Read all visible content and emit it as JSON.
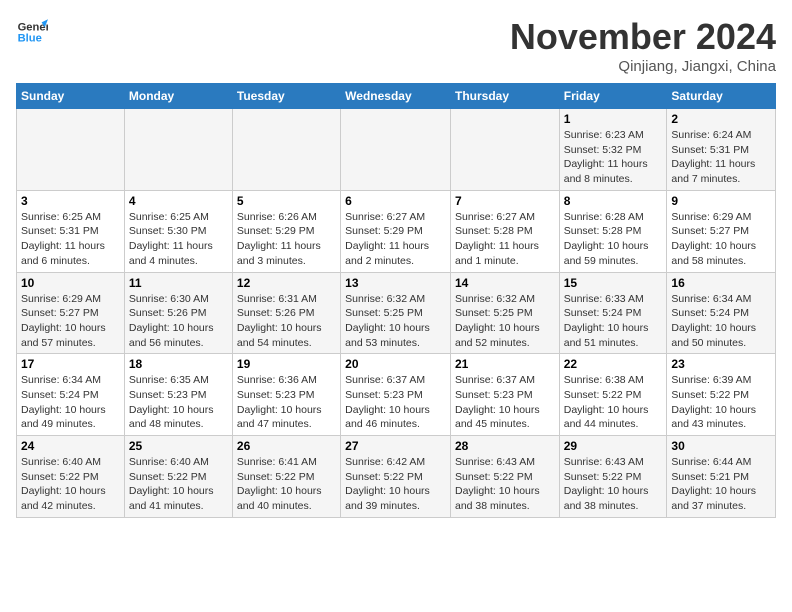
{
  "header": {
    "logo_line1": "General",
    "logo_line2": "Blue",
    "month": "November 2024",
    "location": "Qinjiang, Jiangxi, China"
  },
  "weekdays": [
    "Sunday",
    "Monday",
    "Tuesday",
    "Wednesday",
    "Thursday",
    "Friday",
    "Saturday"
  ],
  "weeks": [
    [
      {
        "day": "",
        "info": ""
      },
      {
        "day": "",
        "info": ""
      },
      {
        "day": "",
        "info": ""
      },
      {
        "day": "",
        "info": ""
      },
      {
        "day": "",
        "info": ""
      },
      {
        "day": "1",
        "info": "Sunrise: 6:23 AM\nSunset: 5:32 PM\nDaylight: 11 hours and 8 minutes."
      },
      {
        "day": "2",
        "info": "Sunrise: 6:24 AM\nSunset: 5:31 PM\nDaylight: 11 hours and 7 minutes."
      }
    ],
    [
      {
        "day": "3",
        "info": "Sunrise: 6:25 AM\nSunset: 5:31 PM\nDaylight: 11 hours and 6 minutes."
      },
      {
        "day": "4",
        "info": "Sunrise: 6:25 AM\nSunset: 5:30 PM\nDaylight: 11 hours and 4 minutes."
      },
      {
        "day": "5",
        "info": "Sunrise: 6:26 AM\nSunset: 5:29 PM\nDaylight: 11 hours and 3 minutes."
      },
      {
        "day": "6",
        "info": "Sunrise: 6:27 AM\nSunset: 5:29 PM\nDaylight: 11 hours and 2 minutes."
      },
      {
        "day": "7",
        "info": "Sunrise: 6:27 AM\nSunset: 5:28 PM\nDaylight: 11 hours and 1 minute."
      },
      {
        "day": "8",
        "info": "Sunrise: 6:28 AM\nSunset: 5:28 PM\nDaylight: 10 hours and 59 minutes."
      },
      {
        "day": "9",
        "info": "Sunrise: 6:29 AM\nSunset: 5:27 PM\nDaylight: 10 hours and 58 minutes."
      }
    ],
    [
      {
        "day": "10",
        "info": "Sunrise: 6:29 AM\nSunset: 5:27 PM\nDaylight: 10 hours and 57 minutes."
      },
      {
        "day": "11",
        "info": "Sunrise: 6:30 AM\nSunset: 5:26 PM\nDaylight: 10 hours and 56 minutes."
      },
      {
        "day": "12",
        "info": "Sunrise: 6:31 AM\nSunset: 5:26 PM\nDaylight: 10 hours and 54 minutes."
      },
      {
        "day": "13",
        "info": "Sunrise: 6:32 AM\nSunset: 5:25 PM\nDaylight: 10 hours and 53 minutes."
      },
      {
        "day": "14",
        "info": "Sunrise: 6:32 AM\nSunset: 5:25 PM\nDaylight: 10 hours and 52 minutes."
      },
      {
        "day": "15",
        "info": "Sunrise: 6:33 AM\nSunset: 5:24 PM\nDaylight: 10 hours and 51 minutes."
      },
      {
        "day": "16",
        "info": "Sunrise: 6:34 AM\nSunset: 5:24 PM\nDaylight: 10 hours and 50 minutes."
      }
    ],
    [
      {
        "day": "17",
        "info": "Sunrise: 6:34 AM\nSunset: 5:24 PM\nDaylight: 10 hours and 49 minutes."
      },
      {
        "day": "18",
        "info": "Sunrise: 6:35 AM\nSunset: 5:23 PM\nDaylight: 10 hours and 48 minutes."
      },
      {
        "day": "19",
        "info": "Sunrise: 6:36 AM\nSunset: 5:23 PM\nDaylight: 10 hours and 47 minutes."
      },
      {
        "day": "20",
        "info": "Sunrise: 6:37 AM\nSunset: 5:23 PM\nDaylight: 10 hours and 46 minutes."
      },
      {
        "day": "21",
        "info": "Sunrise: 6:37 AM\nSunset: 5:23 PM\nDaylight: 10 hours and 45 minutes."
      },
      {
        "day": "22",
        "info": "Sunrise: 6:38 AM\nSunset: 5:22 PM\nDaylight: 10 hours and 44 minutes."
      },
      {
        "day": "23",
        "info": "Sunrise: 6:39 AM\nSunset: 5:22 PM\nDaylight: 10 hours and 43 minutes."
      }
    ],
    [
      {
        "day": "24",
        "info": "Sunrise: 6:40 AM\nSunset: 5:22 PM\nDaylight: 10 hours and 42 minutes."
      },
      {
        "day": "25",
        "info": "Sunrise: 6:40 AM\nSunset: 5:22 PM\nDaylight: 10 hours and 41 minutes."
      },
      {
        "day": "26",
        "info": "Sunrise: 6:41 AM\nSunset: 5:22 PM\nDaylight: 10 hours and 40 minutes."
      },
      {
        "day": "27",
        "info": "Sunrise: 6:42 AM\nSunset: 5:22 PM\nDaylight: 10 hours and 39 minutes."
      },
      {
        "day": "28",
        "info": "Sunrise: 6:43 AM\nSunset: 5:22 PM\nDaylight: 10 hours and 38 minutes."
      },
      {
        "day": "29",
        "info": "Sunrise: 6:43 AM\nSunset: 5:22 PM\nDaylight: 10 hours and 38 minutes."
      },
      {
        "day": "30",
        "info": "Sunrise: 6:44 AM\nSunset: 5:21 PM\nDaylight: 10 hours and 37 minutes."
      }
    ]
  ]
}
